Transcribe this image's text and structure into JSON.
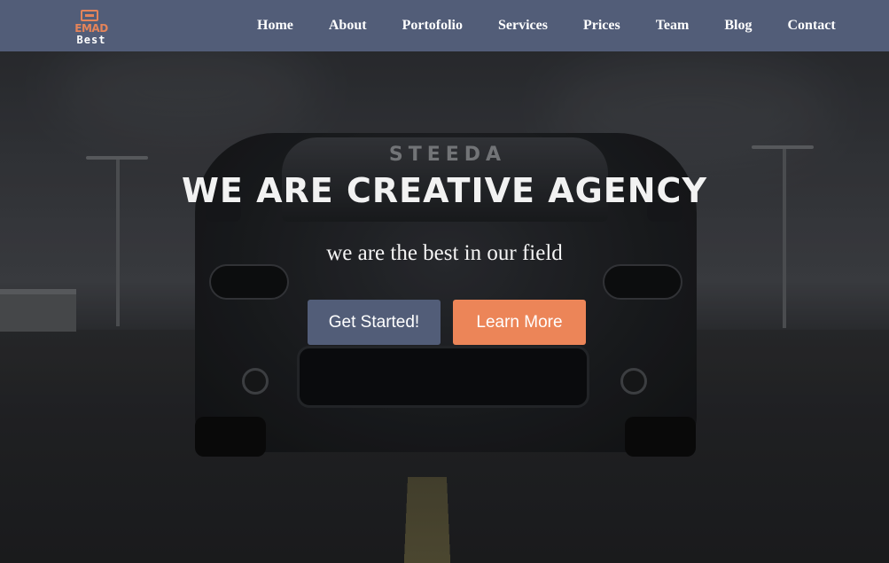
{
  "logo": {
    "main": "EMAD",
    "sub": "Best",
    "accent_color": "#e4845a"
  },
  "navbar": {
    "background": "#525d78",
    "links": [
      {
        "label": "Home"
      },
      {
        "label": "About"
      },
      {
        "label": "Portofolio"
      },
      {
        "label": "Services"
      },
      {
        "label": "Prices"
      },
      {
        "label": "Team"
      },
      {
        "label": "Blog"
      },
      {
        "label": "Contact"
      }
    ]
  },
  "hero": {
    "title": "WE ARE CREATIVE AGENCY",
    "subtitle": "we are the best in our field",
    "windshield_banner": "STEEDA",
    "primary_button": {
      "label": "Get Started!",
      "color": "#525d78"
    },
    "secondary_button": {
      "label": "Learn More",
      "color": "#ec8558"
    }
  }
}
